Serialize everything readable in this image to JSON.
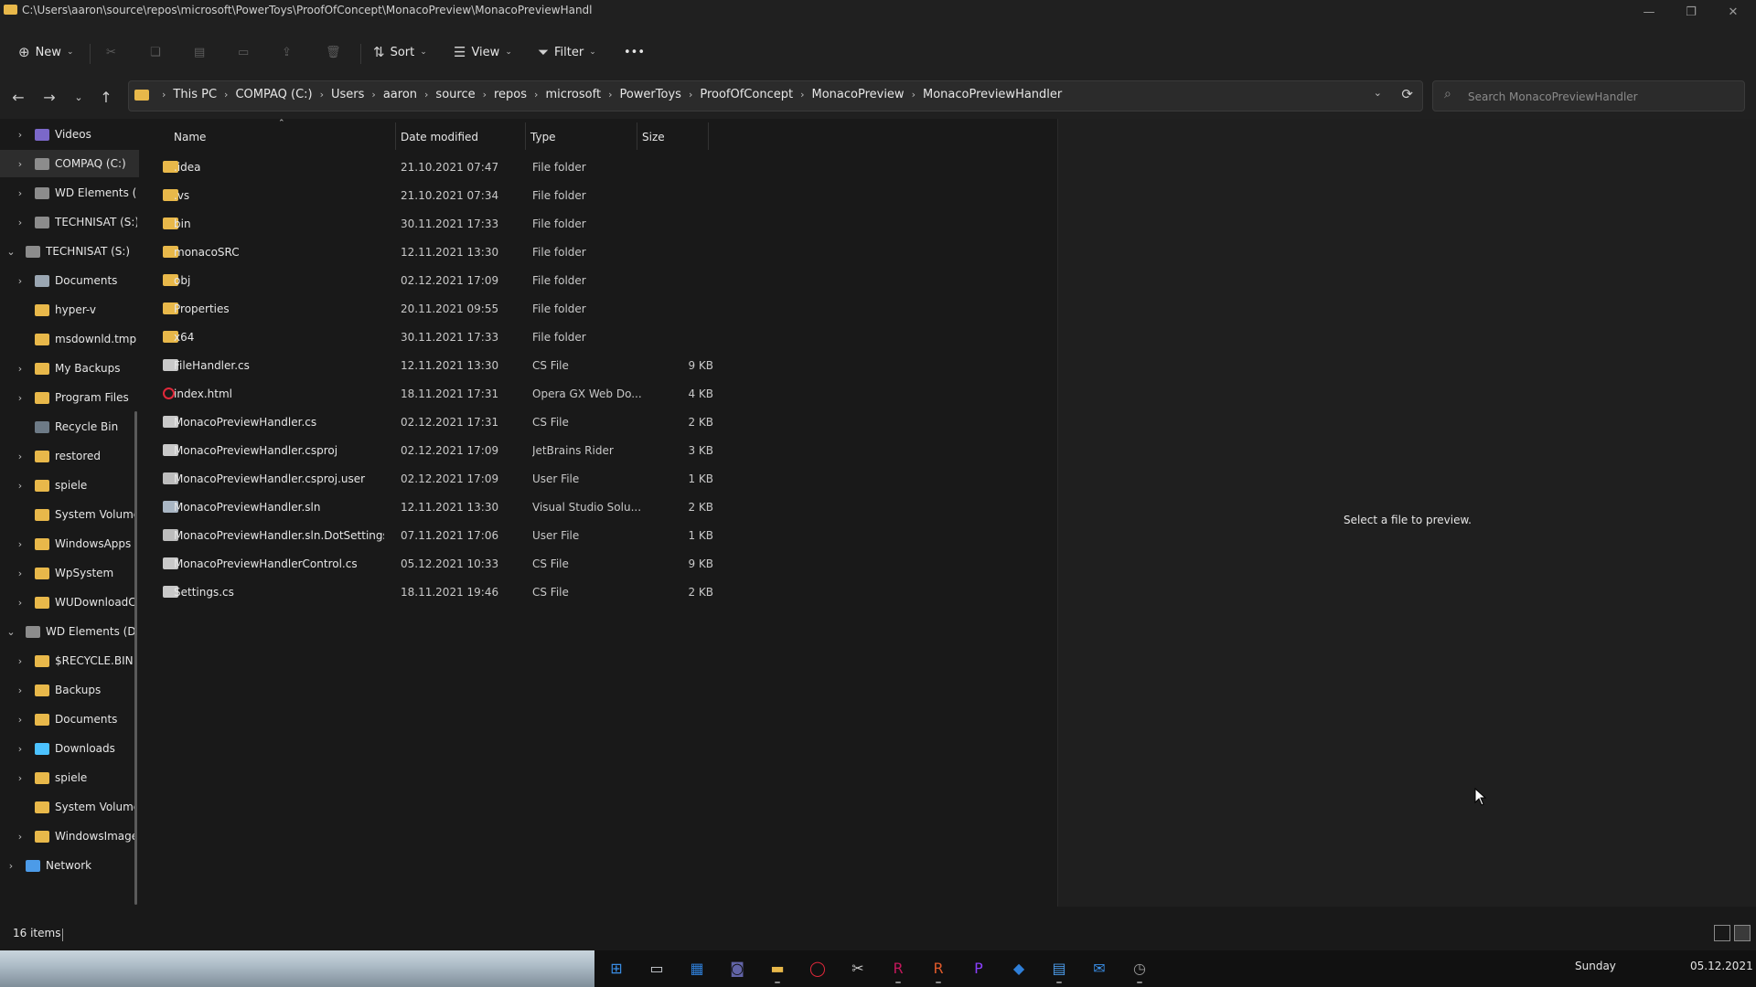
{
  "window": {
    "title": "C:\\Users\\aaron\\source\\repos\\microsoft\\PowerToys\\ProofOfConcept\\MonacoPreview\\MonacoPreviewHandl",
    "controls": [
      "—",
      "❐",
      "✕"
    ]
  },
  "toolbar": {
    "new_label": "New",
    "sort_label": "Sort",
    "view_label": "View",
    "filter_label": "Filter",
    "more_label": "•••"
  },
  "address": {
    "breadcrumbs": [
      "This PC",
      "COMPAQ (C:)",
      "Users",
      "aaron",
      "source",
      "repos",
      "microsoft",
      "PowerToys",
      "ProofOfConcept",
      "MonacoPreview",
      "MonacoPreviewHandler"
    ],
    "search_placeholder": "Search MonacoPreviewHandler"
  },
  "nav_pane": {
    "items": [
      {
        "label": "Videos",
        "icon": "videos-icon",
        "indent": 1,
        "arrow": "›"
      },
      {
        "label": "COMPAQ (C:)",
        "icon": "drive-icon",
        "indent": 1,
        "arrow": "›",
        "selected": true
      },
      {
        "label": "WD Elements (I",
        "icon": "drive-icon",
        "indent": 1,
        "arrow": "›"
      },
      {
        "label": "TECHNISAT (S:)",
        "icon": "drive-icon",
        "indent": 1,
        "arrow": "›"
      },
      {
        "label": "TECHNISAT (S:)",
        "icon": "drive-icon",
        "indent": 0,
        "arrow": "⌄"
      },
      {
        "label": "Documents",
        "icon": "documents-icon",
        "indent": 1,
        "arrow": "›"
      },
      {
        "label": "hyper-v",
        "icon": "folder-icon",
        "indent": 1,
        "arrow": ""
      },
      {
        "label": "msdownld.tmp",
        "icon": "folder-icon",
        "indent": 1,
        "arrow": ""
      },
      {
        "label": "My Backups",
        "icon": "folder-icon",
        "indent": 1,
        "arrow": "›"
      },
      {
        "label": "Program Files",
        "icon": "folder-icon",
        "indent": 1,
        "arrow": "›"
      },
      {
        "label": "Recycle Bin",
        "icon": "recycle-bin-icon",
        "indent": 1,
        "arrow": ""
      },
      {
        "label": "restored",
        "icon": "folder-icon",
        "indent": 1,
        "arrow": "›"
      },
      {
        "label": "spiele",
        "icon": "folder-icon",
        "indent": 1,
        "arrow": "›"
      },
      {
        "label": "System Volume",
        "icon": "folder-icon",
        "indent": 1,
        "arrow": ""
      },
      {
        "label": "WindowsApps",
        "icon": "folder-icon",
        "indent": 1,
        "arrow": "›"
      },
      {
        "label": "WpSystem",
        "icon": "folder-icon",
        "indent": 1,
        "arrow": "›"
      },
      {
        "label": "WUDownloadC",
        "icon": "folder-icon",
        "indent": 1,
        "arrow": "›"
      },
      {
        "label": "WD Elements (D:",
        "icon": "drive-icon",
        "indent": 0,
        "arrow": "⌄"
      },
      {
        "label": "$RECYCLE.BIN",
        "icon": "folder-icon",
        "indent": 1,
        "arrow": "›"
      },
      {
        "label": "Backups",
        "icon": "folder-icon",
        "indent": 1,
        "arrow": "›"
      },
      {
        "label": "Documents",
        "icon": "folder-icon",
        "indent": 1,
        "arrow": "›"
      },
      {
        "label": "Downloads",
        "icon": "downloads-icon",
        "indent": 1,
        "arrow": "›"
      },
      {
        "label": "spiele",
        "icon": "folder-icon",
        "indent": 1,
        "arrow": "›"
      },
      {
        "label": "System Volume",
        "icon": "folder-icon",
        "indent": 1,
        "arrow": ""
      },
      {
        "label": "WindowsImage",
        "icon": "folder-icon",
        "indent": 1,
        "arrow": "›"
      },
      {
        "label": "Network",
        "icon": "network-icon",
        "indent": 0,
        "arrow": "›"
      }
    ]
  },
  "files": {
    "columns": [
      "Name",
      "Date modified",
      "Type",
      "Size"
    ],
    "rows": [
      {
        "name": ".idea",
        "date": "21.10.2021 07:47",
        "type": "File folder",
        "size": "",
        "icon": "folder-icon"
      },
      {
        "name": ".vs",
        "date": "21.10.2021 07:34",
        "type": "File folder",
        "size": "",
        "icon": "folder-icon"
      },
      {
        "name": "bin",
        "date": "30.11.2021 17:33",
        "type": "File folder",
        "size": "",
        "icon": "folder-icon"
      },
      {
        "name": "monacoSRC",
        "date": "12.11.2021 13:30",
        "type": "File folder",
        "size": "",
        "icon": "folder-icon"
      },
      {
        "name": "obj",
        "date": "02.12.2021 17:09",
        "type": "File folder",
        "size": "",
        "icon": "folder-icon"
      },
      {
        "name": "Properties",
        "date": "20.11.2021 09:55",
        "type": "File folder",
        "size": "",
        "icon": "folder-icon"
      },
      {
        "name": "x64",
        "date": "30.11.2021 17:33",
        "type": "File folder",
        "size": "",
        "icon": "folder-icon"
      },
      {
        "name": "FileHandler.cs",
        "date": "12.11.2021 13:30",
        "type": "CS File",
        "size": "9 KB",
        "icon": "rider-file-icon"
      },
      {
        "name": "index.html",
        "date": "18.11.2021 17:31",
        "type": "Opera GX Web Do...",
        "size": "4 KB",
        "icon": "opera-file-icon"
      },
      {
        "name": "MonacoPreviewHandler.cs",
        "date": "02.12.2021 17:31",
        "type": "CS File",
        "size": "2 KB",
        "icon": "rider-file-icon"
      },
      {
        "name": "MonacoPreviewHandler.csproj",
        "date": "02.12.2021 17:09",
        "type": "JetBrains Rider",
        "size": "3 KB",
        "icon": "rider-file-icon"
      },
      {
        "name": "MonacoPreviewHandler.csproj.user",
        "date": "02.12.2021 17:09",
        "type": "User File",
        "size": "1 KB",
        "icon": "generic-file-icon"
      },
      {
        "name": "MonacoPreviewHandler.sln",
        "date": "12.11.2021 13:30",
        "type": "Visual Studio Solu...",
        "size": "2 KB",
        "icon": "solution-file-icon"
      },
      {
        "name": "MonacoPreviewHandler.sln.DotSettings....",
        "date": "07.11.2021 17:06",
        "type": "User File",
        "size": "1 KB",
        "icon": "generic-file-icon"
      },
      {
        "name": "MonacoPreviewHandlerControl.cs",
        "date": "05.12.2021 10:33",
        "type": "CS File",
        "size": "9 KB",
        "icon": "rider-file-icon"
      },
      {
        "name": "Settings.cs",
        "date": "18.11.2021 19:46",
        "type": "CS File",
        "size": "2 KB",
        "icon": "rider-file-icon"
      }
    ]
  },
  "preview": {
    "message": "Select a file to preview."
  },
  "status": {
    "item_count": "16 items"
  },
  "taskbar": {
    "day": "Sunday",
    "date": "05.12.2021",
    "apps": [
      "start-icon",
      "task-view-icon",
      "widgets-icon",
      "teams-chat-icon",
      "file-explorer-icon",
      "opera-gx-icon",
      "snipping-tool-icon",
      "rider-icon",
      "rider-eap-icon",
      "phpstorm-icon",
      "visual-studio-icon",
      "notepad-icon",
      "mail-icon",
      "clock-app-icon"
    ]
  },
  "colors": {
    "accent": "#4cc2ff",
    "folder": "#e8b84a",
    "background": "#191919"
  }
}
